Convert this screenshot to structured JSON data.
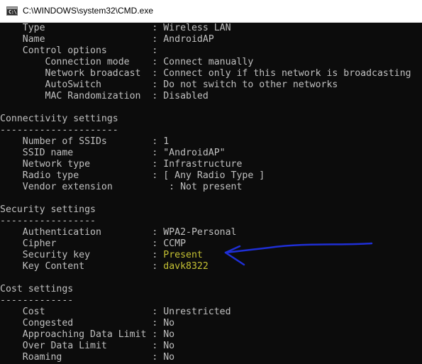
{
  "window": {
    "title": "C:\\WINDOWS\\system32\\CMD.exe",
    "icon": "cmd-console-icon",
    "icon_text": "C:\\"
  },
  "annotation": {
    "arrow_color": "#1f2fd6"
  },
  "colors": {
    "console_background": "#0c0c0c",
    "console_text": "#c0c0c0",
    "highlight_text": "#c5c133"
  },
  "console": {
    "lines": [
      "    Type                   : Wireless LAN",
      "    Name                   : AndroidAP",
      "    Control options        :",
      "        Connection mode    : Connect manually",
      "        Network broadcast  : Connect only if this network is broadcasting",
      "        AutoSwitch         : Do not switch to other networks",
      "        MAC Randomization  : Disabled",
      "",
      "Connectivity settings",
      "---------------------",
      "    Number of SSIDs        : 1",
      "    SSID name              : \"AndroidAP\"",
      "    Network type           : Infrastructure",
      "    Radio type             : [ Any Radio Type ]",
      "    Vendor extension          : Not present",
      "",
      "Security settings",
      "-----------------",
      "    Authentication         : WPA2-Personal",
      "    Cipher                 : CCMP",
      "    Security key           : ",
      "    Key Content            : ",
      "",
      "Cost settings",
      "-------------",
      "    Cost                   : Unrestricted",
      "    Congested              : No",
      "    Approaching Data Limit : No",
      "    Over Data Limit        : No",
      "    Roaming                : No"
    ],
    "security_key_value": "Present",
    "key_content_value": "davk8322"
  }
}
